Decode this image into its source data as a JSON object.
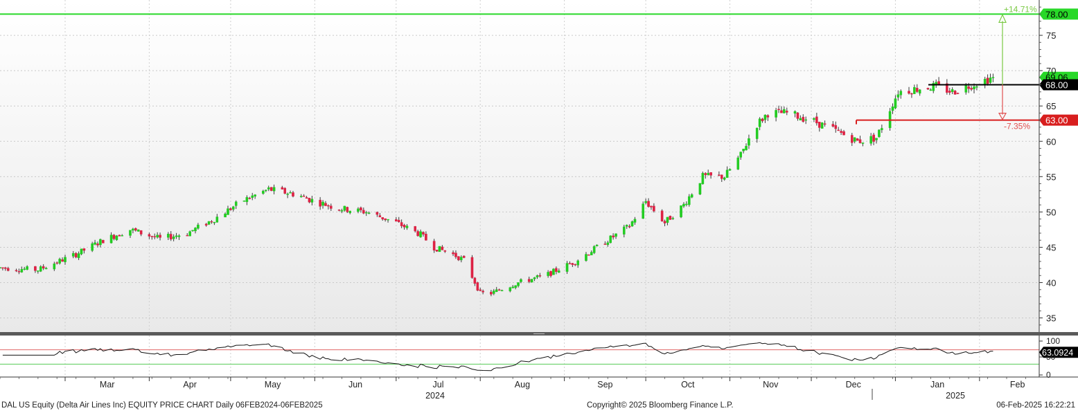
{
  "chart_data": {
    "type": "candlestick",
    "title": "DAL US Equity (Delta Air Lines Inc) EQUITY PRICE CHART  Daily 06FEB2024-06FEB2025",
    "price_axis": {
      "ylim": [
        33,
        80
      ],
      "ticks": [
        35,
        40,
        45,
        50,
        55,
        60,
        65,
        70,
        75
      ]
    },
    "x_axis": {
      "months": [
        "Mar",
        "Apr",
        "May",
        "Jun",
        "Jul",
        "Aug",
        "Sep",
        "Oct",
        "Nov",
        "Dec",
        "Jan",
        "Feb"
      ],
      "years": [
        "2024",
        "2025"
      ]
    },
    "price_path": [
      [
        "2024-02-06",
        42.1
      ],
      [
        "2024-02-20",
        41.8
      ],
      [
        "2024-03-05",
        44.0
      ],
      [
        "2024-03-15",
        46.0
      ],
      [
        "2024-03-25",
        47.5
      ],
      [
        "2024-04-05",
        46.2
      ],
      [
        "2024-04-15",
        47.0
      ],
      [
        "2024-04-25",
        49.0
      ],
      [
        "2024-05-05",
        51.5
      ],
      [
        "2024-05-15",
        53.2
      ],
      [
        "2024-05-25",
        52.5
      ],
      [
        "2024-06-01",
        51.5
      ],
      [
        "2024-06-10",
        50.5
      ],
      [
        "2024-06-20",
        50.0
      ],
      [
        "2024-07-01",
        48.5
      ],
      [
        "2024-07-10",
        46.8
      ],
      [
        "2024-07-15",
        45.0
      ],
      [
        "2024-07-22",
        44.0
      ],
      [
        "2024-07-26",
        43.2
      ],
      [
        "2024-08-01",
        38.5
      ],
      [
        "2024-08-05",
        38.5
      ],
      [
        "2024-08-15",
        40.0
      ],
      [
        "2024-08-25",
        41.0
      ],
      [
        "2024-09-05",
        43.0
      ],
      [
        "2024-09-15",
        45.5
      ],
      [
        "2024-09-25",
        48.0
      ],
      [
        "2024-10-01",
        51.5
      ],
      [
        "2024-10-08",
        48.5
      ],
      [
        "2024-10-15",
        51.0
      ],
      [
        "2024-10-22",
        55.0
      ],
      [
        "2024-10-30",
        55.0
      ],
      [
        "2024-11-05",
        58.0
      ],
      [
        "2024-11-10",
        62.0
      ],
      [
        "2024-11-15",
        64.0
      ],
      [
        "2024-11-22",
        64.0
      ],
      [
        "2024-12-01",
        63.0
      ],
      [
        "2024-12-10",
        61.5
      ],
      [
        "2024-12-18",
        60.0
      ],
      [
        "2024-12-25",
        60.5
      ],
      [
        "2025-01-02",
        67.0
      ],
      [
        "2025-01-10",
        67.5
      ],
      [
        "2025-01-16",
        67.8
      ],
      [
        "2025-01-22",
        67.0
      ],
      [
        "2025-01-29",
        68.0
      ],
      [
        "2025-02-06",
        69.06
      ]
    ],
    "price_levels": [
      {
        "label": "78.00",
        "value": 78.0,
        "color": "#28d828"
      },
      {
        "label": "69.06",
        "value": 69.06,
        "color": "#28d828"
      },
      {
        "label": "68.00",
        "value": 68.0,
        "color": "#000000"
      },
      {
        "label": "63.00",
        "value": 63.0,
        "color": "#d81e1e"
      }
    ],
    "annotations": [
      {
        "text": "+14.71%",
        "color": "#7ac943"
      },
      {
        "text": "-7.35%",
        "color": "#e05050"
      }
    ],
    "rsi": {
      "ylim": [
        0,
        100
      ],
      "ticks": [
        0,
        50,
        100
      ],
      "overbought": 70,
      "oversold": 30,
      "last": "63.0924"
    },
    "colors": {
      "up": "#22cc22",
      "down": "#dd2244",
      "background_top": "#ffffff",
      "background_bottom": "#eaeaea"
    }
  },
  "footer": {
    "left": "DAL US Equity (Delta Air Lines Inc) EQUITY PRICE CHART  Daily 06FEB2024-06FEB2025",
    "center": "Copyright© 2025 Bloomberg Finance L.P.",
    "right": "06-Feb-2025 16:22:21"
  }
}
